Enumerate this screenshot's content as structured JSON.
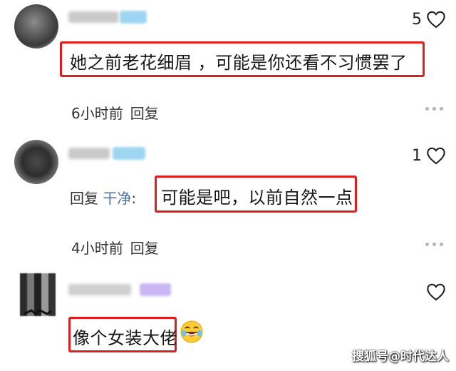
{
  "comments": [
    {
      "likes": "5",
      "text": "她之前老花细眉 ，可能是你还看不习惯罢了",
      "time": "6小时前",
      "reply_label": "回复"
    },
    {
      "likes": "1",
      "reply_prefix": "回复",
      "mention": "干净",
      "colon": ":",
      "text": "可能是吧，以前自然一点",
      "time": "4小时前",
      "reply_label": "回复"
    },
    {
      "likes": "",
      "text": "像个女装大佬",
      "emoji": "laughing-crying-emoji"
    }
  ],
  "colors": {
    "highlight": "#e01c1c",
    "mention": "#4a6ea8",
    "badge_blue": "#9ed6f2",
    "badge_purple": "#c9b6f2"
  },
  "watermark": "搜狐号@时代达人"
}
